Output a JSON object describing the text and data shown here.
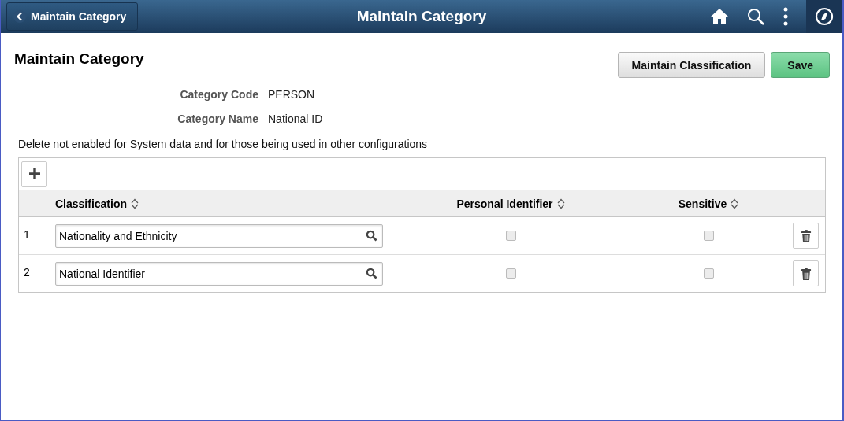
{
  "header": {
    "back_button": "Maintain Category",
    "title": "Maintain Category"
  },
  "page": {
    "title": "Maintain Category",
    "buttons": [
      "Maintain Classification",
      "Save"
    ]
  },
  "fields": [
    {
      "label": "Category Code",
      "value": "PERSON"
    },
    {
      "label": "Category Name",
      "value": "National ID"
    }
  ],
  "note": "Delete not enabled for System data and for those being used in other configurations",
  "table": {
    "columns": [
      "Classification",
      "Personal Identifier",
      "Sensitive"
    ],
    "rows": [
      {
        "number": "1",
        "classification": "Nationality and Ethnicity",
        "personal_identifier": {
          "checked": false,
          "disabled": true
        },
        "sensitive": {
          "checked": false,
          "disabled": true
        }
      },
      {
        "number": "2",
        "classification": "National Identifier",
        "personal_identifier": {
          "checked": false,
          "disabled": true
        },
        "sensitive": {
          "checked": false,
          "disabled": true
        }
      }
    ]
  }
}
